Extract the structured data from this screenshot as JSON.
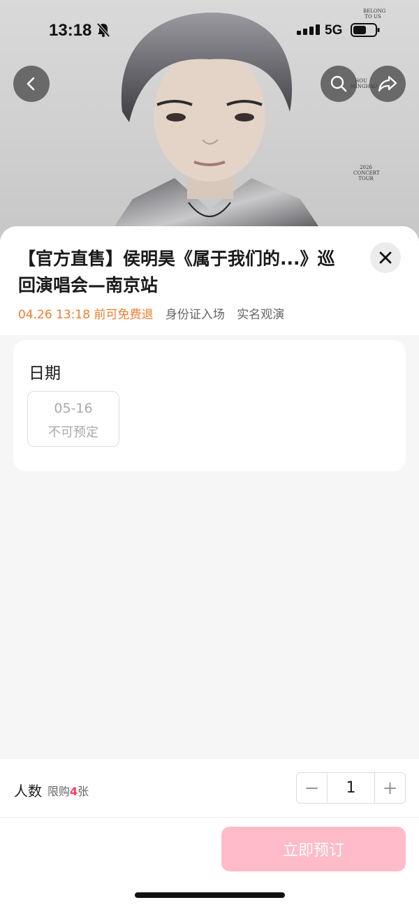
{
  "status_bar": {
    "time": "13:18",
    "network": "5G",
    "icons": [
      "bell-muted-icon",
      "signal-icon",
      "battery-icon"
    ]
  },
  "hero": {
    "poster_text_top": "BELONG TO US",
    "poster_text_name": "HOU MINGHAO",
    "poster_text_tour": "2026 CONCERT TOUR"
  },
  "nav": {
    "icons": [
      "chevron-left-icon",
      "search-icon",
      "share-icon"
    ]
  },
  "event": {
    "title": "【官方直售】侯明昊《属于我们的...》巡回演唱会—南京站",
    "refund_tag": "04.26 13:18 前可免费退",
    "id_entry_tag": "身份证入场",
    "real_name_tag": "实名观演"
  },
  "date_section": {
    "label": "日期",
    "options": [
      {
        "date": "05-16",
        "status": "不可预定"
      }
    ]
  },
  "quantity": {
    "label": "人数",
    "limit_prefix": "限购",
    "limit_count": "4",
    "limit_suffix": "张",
    "value": "1",
    "minus": "−",
    "plus": "+"
  },
  "action": {
    "book_label": "立即预订"
  },
  "colors": {
    "accent_orange": "#f07b2c",
    "limit_red": "#ff3b5c",
    "button_disabled_pink": "#ffbbc7"
  }
}
